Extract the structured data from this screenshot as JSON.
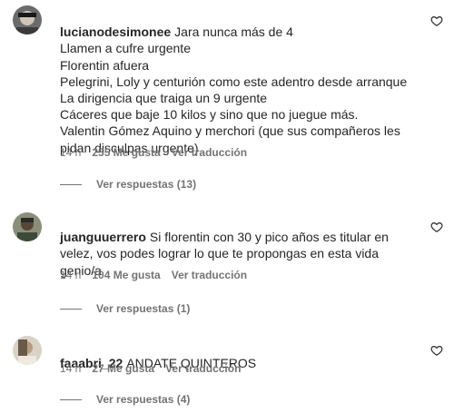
{
  "comments": [
    {
      "username": "lucianodesimonee",
      "text_first": "Jara nunca más de 4",
      "text_rest": "Llamen a cufre urgente\nFlorentin afuera\nPelegrini, Loly y centurión como este adentro desde arranque\nLa dirigencia que traiga un 9 urgente\nCáceres que baje 10 kilos y sino que no juegue más.\nValentin Gómez Aquino y merchori (que sus compañeros les pidan disculpas urgente)",
      "time": "14 h",
      "likes": "255 Me gusta",
      "translate": "Ver traducción",
      "view_replies": "Ver respuestas (13)"
    },
    {
      "username": "juanguuerrero",
      "text_first": "Si florentin con 30 y pico años es titular en velez, vos podes lograr lo que te propongas en esta vida genio/a",
      "text_rest": "",
      "time": "14 h",
      "likes": "104 Me gusta",
      "translate": "Ver traducción",
      "view_replies": "Ver respuestas (1)"
    },
    {
      "username": "faaabri_22",
      "text_first": "ANDATE QUINTEROS",
      "text_rest": "",
      "time": "14 h",
      "likes": "27 Me gusta",
      "translate": "Ver traducción",
      "view_replies": "Ver respuestas (4)"
    }
  ],
  "colors": {
    "text": "#262626",
    "secondary": "#737373",
    "background": "#ffffff"
  },
  "icons": {
    "like": "heart-outline-icon"
  }
}
